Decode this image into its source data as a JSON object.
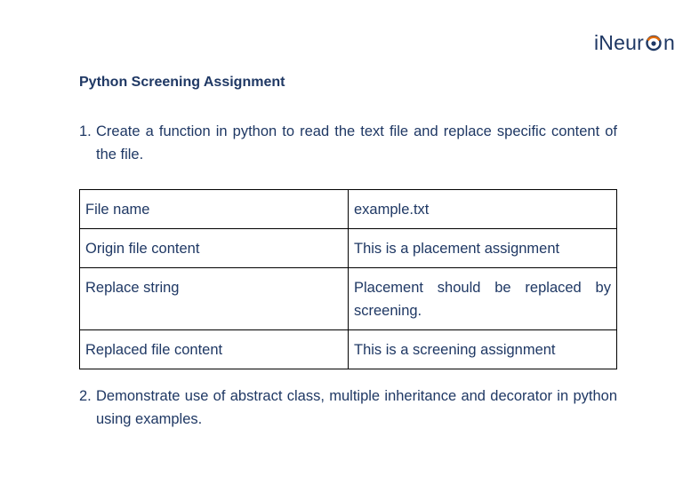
{
  "logo": {
    "text_before": "iNeur",
    "text_after": "n",
    "colors": {
      "text": "#1f3864",
      "ring": "#e36c09"
    }
  },
  "title": "Python Screening Assignment",
  "questions": [
    {
      "number": "1.",
      "text": "Create a function in python to read the text file and replace specific content of the file."
    },
    {
      "number": "2.",
      "text": "Demonstrate use of abstract class, multiple inheritance and decorator in python using examples."
    }
  ],
  "table": {
    "rows": [
      [
        "File name",
        "example.txt"
      ],
      [
        "Origin file content",
        "This is a placement assignment"
      ],
      [
        "Replace string",
        "Placement should be replaced by screening."
      ],
      [
        "Replaced file content",
        "This is a screening assignment"
      ]
    ]
  },
  "colors": {
    "text": "#1f3864",
    "border": "#000000"
  }
}
